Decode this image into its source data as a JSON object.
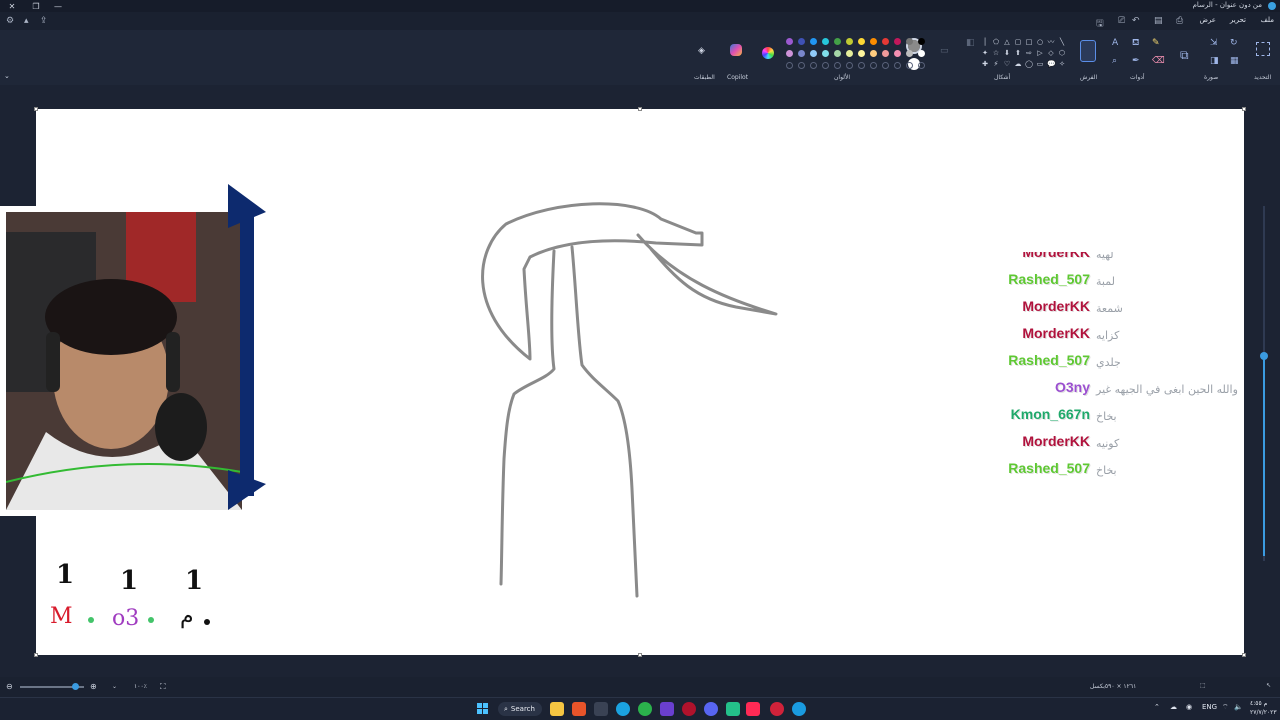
{
  "window": {
    "title": "من دون عنوان - الرسام",
    "controls": [
      "close-icon",
      "restore-icon",
      "minimize-icon"
    ]
  },
  "menu": {
    "file": "ملف",
    "edit": "تحرير",
    "view": "عرض"
  },
  "ribbon": {
    "groups": {
      "selection": "التحديد",
      "image": "صورة",
      "tools": "أدوات",
      "brushes": "الفرش",
      "shapes": "أشكال",
      "colors": "الألوان",
      "copilot": "Copilot",
      "layers": "الطبقات"
    },
    "colors": {
      "row1": [
        "#9b59d0",
        "#3f51b5",
        "#2196f3",
        "#26c6da",
        "#43a047",
        "#c0ca33",
        "#fdd835",
        "#fb8c00",
        "#e53935",
        "#c2185b",
        "#757575",
        "#000000"
      ],
      "row2": [
        "#ce93d8",
        "#7986cb",
        "#90caf9",
        "#80deea",
        "#a5d6a7",
        "#e6ee9c",
        "#fff59d",
        "#ffcc80",
        "#ef9a9a",
        "#f48fb1",
        "#bdbdbd",
        "#ffffff"
      ],
      "primary": "#8a8a8a",
      "secondary": "#ffffff"
    }
  },
  "chat": {
    "rows": [
      {
        "user": "MorderKK",
        "msg": "لهيه",
        "color": "#b0123c"
      },
      {
        "user": "Rashed_507",
        "msg": "لمبة",
        "color": "#5ec832"
      },
      {
        "user": "MorderKK",
        "msg": "شمعة",
        "color": "#b0123c"
      },
      {
        "user": "MorderKK",
        "msg": "كزايه",
        "color": "#b0123c"
      },
      {
        "user": "Rashed_507",
        "msg": "جلدي",
        "color": "#5ec832"
      },
      {
        "user": "O3ny",
        "msg": "والله الحين ابغى في الجيهه غير",
        "color": "#9b4fd0"
      },
      {
        "user": "Kmon_667n",
        "msg": "بخاخ",
        "color": "#1fa86a"
      },
      {
        "user": "MorderKK",
        "msg": "كونيه",
        "color": "#b0123c"
      },
      {
        "user": "Rashed_507",
        "msg": "بخاخ",
        "color": "#5ec832"
      }
    ]
  },
  "scoreboard": {
    "players": [
      {
        "score": "1",
        "name": "M",
        "color": "#d81b2c",
        "dot": "#43c46a"
      },
      {
        "score": "1",
        "name": "o3",
        "color": "#a03cc0",
        "dot": "#43c46a"
      },
      {
        "score": "1",
        "name": "م",
        "color": "#111111",
        "dot": "#111111"
      }
    ]
  },
  "status": {
    "canvas_size": "١٢٦١ × ٥٩٠بكسل",
    "zoom": "١٠٠٪"
  },
  "taskbar": {
    "search": "Search",
    "lang": "ENG",
    "time": "م ٤:٥٥",
    "date": "٢٧/٧/٢٠٢٣"
  }
}
